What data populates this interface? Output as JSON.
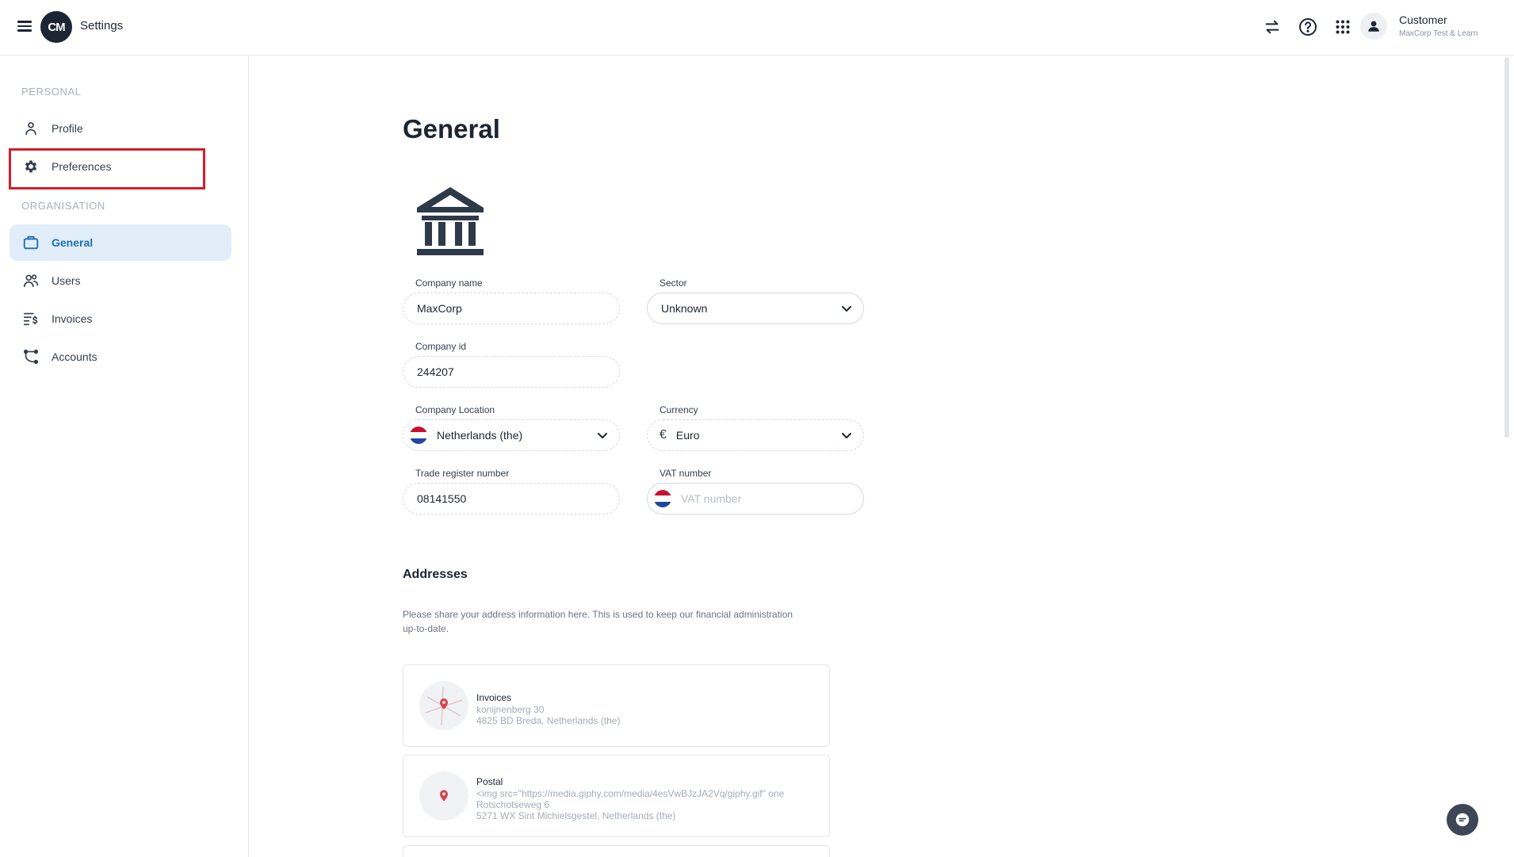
{
  "header": {
    "app_title": "Settings",
    "logo_text": "CM",
    "icons": [
      "swap-icon",
      "help-icon",
      "apps-grid-icon",
      "user-avatar-icon"
    ],
    "user_name": "Customer",
    "user_org": "MaxCorp Test & Learn"
  },
  "sidebar": {
    "personal_label": "PERSONAL",
    "organisation_label": "ORGANISATION",
    "personal_items": [
      {
        "label": "Profile",
        "icon": "person-icon"
      },
      {
        "label": "Preferences",
        "icon": "gear-icon"
      }
    ],
    "organisation_items": [
      {
        "label": "General",
        "icon": "briefcase-icon",
        "active": true
      },
      {
        "label": "Users",
        "icon": "users-icon"
      },
      {
        "label": "Invoices",
        "icon": "invoice-icon"
      },
      {
        "label": "Accounts",
        "icon": "accounts-icon"
      }
    ]
  },
  "main": {
    "title": "General",
    "form": {
      "company_name": {
        "label": "Company name",
        "value": "MaxCorp"
      },
      "sector": {
        "label": "Sector",
        "value": "Unknown"
      },
      "company_id": {
        "label": "Company id",
        "value": "244207"
      },
      "company_location": {
        "label": "Company Location",
        "value": "Netherlands (the)"
      },
      "currency": {
        "label": "Currency",
        "value": "Euro",
        "symbol": "€"
      },
      "trade_register": {
        "label": "Trade register number",
        "value": "08141550"
      },
      "vat": {
        "label": "VAT number",
        "placeholder": "VAT number"
      }
    },
    "addresses": {
      "title": "Addresses",
      "description": "Please share your address information here. This is used to keep our financial administration up-to-date.",
      "cards": [
        {
          "title": "Invoices",
          "lines": [
            "konijnenberg 30",
            "4825 BD Breda, Netherlands (the)"
          ]
        },
        {
          "title": "Postal",
          "lines": [
            "<img src=\"https://media.giphy.com/media/4esVwBJzJA2Vq/giphy.gif\" one",
            "Rotschotseweg 6",
            "5271 WX Sint Michielsgestel, Netherlands (the)"
          ]
        }
      ]
    }
  },
  "colors": {
    "accent": "#1b6fb4",
    "active_bg": "#e1eefa",
    "highlight": "#d0202a",
    "dark": "#1c2533"
  }
}
